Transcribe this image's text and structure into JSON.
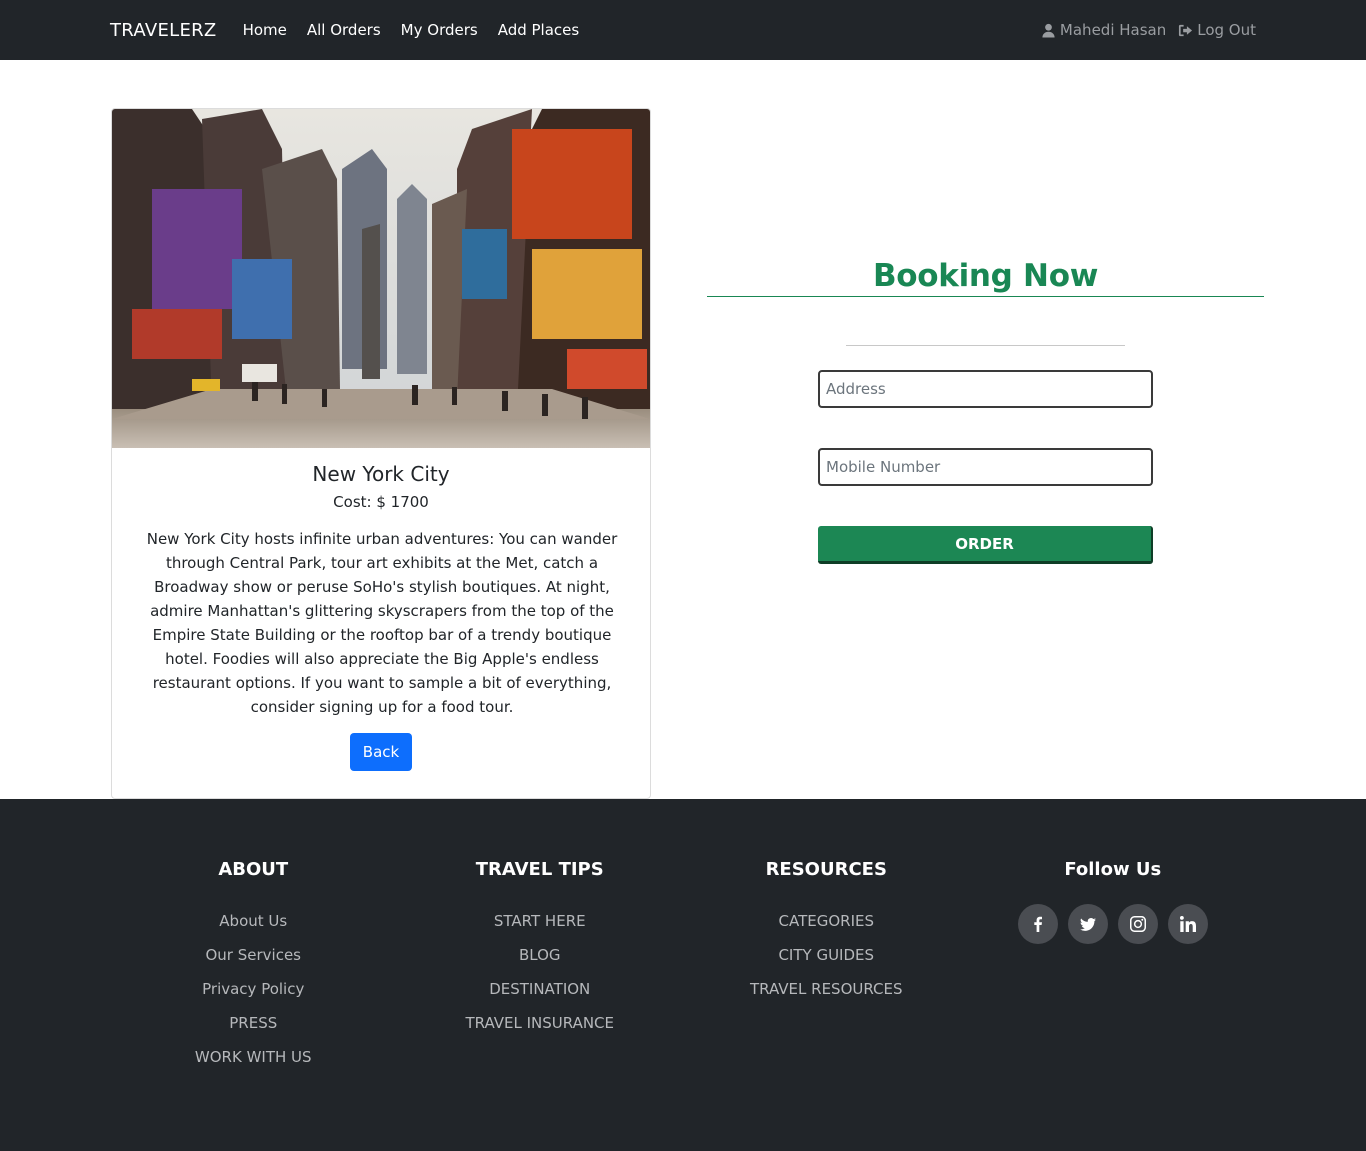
{
  "navbar": {
    "brand": "TRAVELERZ",
    "links": [
      "Home",
      "All Orders",
      "My Orders",
      "Add Places"
    ],
    "user_name": "Mahedi Hasan",
    "logout_label": "Log Out",
    "bg_color": "#212529"
  },
  "place": {
    "title": "New York City",
    "cost": "Cost: $ 1700",
    "description": "New York City hosts infinite urban adventures: You can wander through Central Park, tour art exhibits at the Met, catch a Broadway show or peruse SoHo's stylish boutiques. At night, admire Manhattan's glittering skyscrapers from the top of the Empire State Building or the rooftop bar of a trendy boutique hotel. Foodies will also appreciate the Big Apple's endless restaurant options. If you want to sample a bit of everything, consider signing up for a food tour.",
    "back_label": "Back"
  },
  "booking": {
    "title": "Booking Now",
    "address_placeholder": "Address",
    "mobile_placeholder": "Mobile Number",
    "order_label": "ORDER",
    "accent_color": "#198754"
  },
  "footer": {
    "about": {
      "heading": "ABOUT",
      "items": [
        "About Us",
        "Our Services",
        "Privacy Policy",
        "PRESS",
        "WORK WITH US"
      ]
    },
    "travel_tips": {
      "heading": "TRAVEL TIPS",
      "items": [
        "START HERE",
        "BLOG",
        "DESTINATION",
        "TRAVEL INSURANCE"
      ]
    },
    "resources": {
      "heading": "RESOURCES",
      "items": [
        "CATEGORIES",
        "CITY GUIDES",
        "TRAVEL RESOURCES"
      ]
    },
    "follow": {
      "heading": "Follow Us",
      "icons": [
        "facebook-icon",
        "twitter-icon",
        "instagram-icon",
        "linkedin-icon"
      ]
    }
  }
}
